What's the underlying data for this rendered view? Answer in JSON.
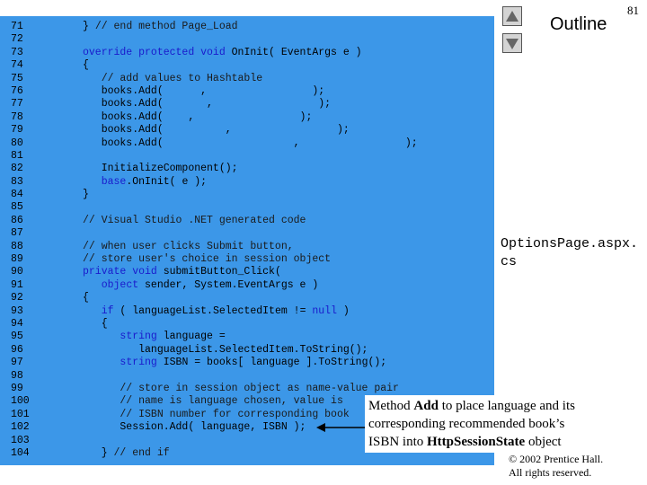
{
  "slide": {
    "page_number": "81",
    "outline_label": "Outline",
    "filename": "OptionsPage.aspx.\ncs",
    "copyright_line1": "© 2002 Prentice Hall.",
    "copyright_line2": "All rights reserved."
  },
  "callout": {
    "before_add": "Method ",
    "add_word": "Add",
    "after_add": " to place language and its corresponding recommended book’s ISBN into ",
    "state_word": "HttpSessionState",
    "after_state": " object"
  },
  "code_lines": [
    {
      "num": "71",
      "tokens": [
        {
          "t": "} ",
          "k": "t"
        },
        {
          "t": "// end method Page_Load",
          "k": "c"
        }
      ]
    },
    {
      "num": "72",
      "tokens": []
    },
    {
      "num": "73",
      "tokens": [
        {
          "t": "override protected void ",
          "k": "k"
        },
        {
          "t": "OnInit( EventArgs e )",
          "k": "t"
        }
      ]
    },
    {
      "num": "74",
      "tokens": [
        {
          "t": "{",
          "k": "t"
        }
      ]
    },
    {
      "num": "75",
      "tokens": [
        {
          "t": "   // add values to Hashtable",
          "k": "c"
        }
      ]
    },
    {
      "num": "76",
      "tokens": [
        {
          "t": "   books.Add(      ,                 );",
          "k": "t"
        }
      ]
    },
    {
      "num": "77",
      "tokens": [
        {
          "t": "   books.Add(       ,                 );",
          "k": "t"
        }
      ]
    },
    {
      "num": "78",
      "tokens": [
        {
          "t": "   books.Add(    ,                 );",
          "k": "t"
        }
      ]
    },
    {
      "num": "79",
      "tokens": [
        {
          "t": "   books.Add(          ,                 );",
          "k": "t"
        }
      ]
    },
    {
      "num": "80",
      "tokens": [
        {
          "t": "   books.Add(                     ,                 );",
          "k": "t"
        }
      ]
    },
    {
      "num": "81",
      "tokens": []
    },
    {
      "num": "82",
      "tokens": [
        {
          "t": "   InitializeComponent();",
          "k": "t"
        }
      ]
    },
    {
      "num": "83",
      "tokens": [
        {
          "t": "   ",
          "k": "t"
        },
        {
          "t": "base",
          "k": "k"
        },
        {
          "t": ".OnInit( e );",
          "k": "t"
        }
      ]
    },
    {
      "num": "84",
      "tokens": [
        {
          "t": "}",
          "k": "t"
        }
      ]
    },
    {
      "num": "85",
      "tokens": []
    },
    {
      "num": "86",
      "tokens": [
        {
          "t": "// Visual Studio .NET generated code",
          "k": "c"
        }
      ]
    },
    {
      "num": "87",
      "tokens": []
    },
    {
      "num": "88",
      "tokens": [
        {
          "t": "// when user clicks Submit button,",
          "k": "c"
        }
      ]
    },
    {
      "num": "89",
      "tokens": [
        {
          "t": "// store user's choice in session object",
          "k": "c"
        }
      ]
    },
    {
      "num": "90",
      "tokens": [
        {
          "t": "private void ",
          "k": "k"
        },
        {
          "t": "submitButton_Click(",
          "k": "t"
        }
      ]
    },
    {
      "num": "91",
      "tokens": [
        {
          "t": "   ",
          "k": "t"
        },
        {
          "t": "object ",
          "k": "k"
        },
        {
          "t": "sender, System.EventArgs e )",
          "k": "t"
        }
      ]
    },
    {
      "num": "92",
      "tokens": [
        {
          "t": "{",
          "k": "t"
        }
      ]
    },
    {
      "num": "93",
      "tokens": [
        {
          "t": "   ",
          "k": "t"
        },
        {
          "t": "if",
          "k": "k"
        },
        {
          "t": " ( languageList.SelectedItem != ",
          "k": "t"
        },
        {
          "t": "null",
          "k": "k"
        },
        {
          "t": " )",
          "k": "t"
        }
      ]
    },
    {
      "num": "94",
      "tokens": [
        {
          "t": "   {",
          "k": "t"
        }
      ]
    },
    {
      "num": "95",
      "tokens": [
        {
          "t": "      ",
          "k": "t"
        },
        {
          "t": "string",
          "k": "k"
        },
        {
          "t": " language =",
          "k": "t"
        }
      ]
    },
    {
      "num": "96",
      "tokens": [
        {
          "t": "         languageList.SelectedItem.ToString();",
          "k": "t"
        }
      ]
    },
    {
      "num": "97",
      "tokens": [
        {
          "t": "      ",
          "k": "t"
        },
        {
          "t": "string",
          "k": "k"
        },
        {
          "t": " ISBN = books[ language ].ToString();",
          "k": "t"
        }
      ]
    },
    {
      "num": "98",
      "tokens": []
    },
    {
      "num": "99",
      "tokens": [
        {
          "t": "      // store in session object as name-value pair",
          "k": "c"
        }
      ]
    },
    {
      "num": "100",
      "tokens": [
        {
          "t": "      // name is language chosen, value is",
          "k": "c"
        }
      ]
    },
    {
      "num": "101",
      "tokens": [
        {
          "t": "      // ISBN number for corresponding book",
          "k": "c"
        }
      ]
    },
    {
      "num": "102",
      "tokens": [
        {
          "t": "      Session.Add( language, ISBN );",
          "k": "t"
        }
      ]
    },
    {
      "num": "103",
      "tokens": []
    },
    {
      "num": "104",
      "tokens": [
        {
          "t": "   } ",
          "k": "t"
        },
        {
          "t": "// end if",
          "k": "c"
        }
      ]
    }
  ]
}
